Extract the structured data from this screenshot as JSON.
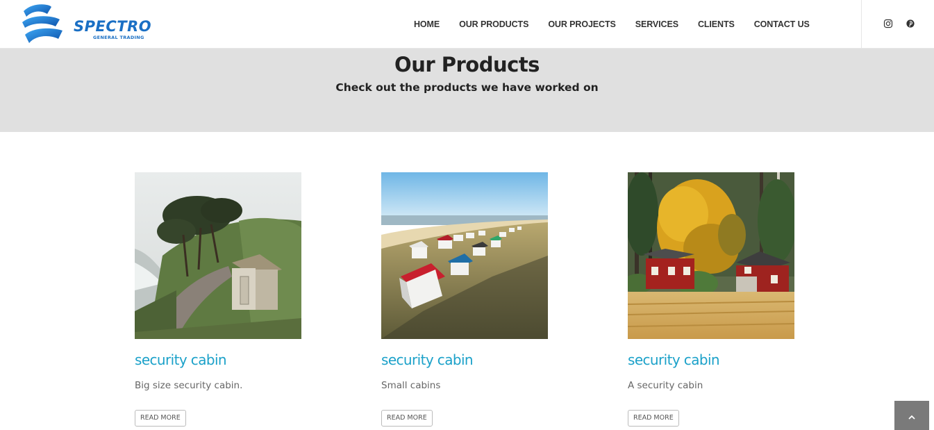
{
  "brand": {
    "name": "SPECTRO",
    "tagline": "GENERAL TRADING",
    "color": "#1a6fc4"
  },
  "nav": {
    "items": [
      {
        "label": "HOME"
      },
      {
        "label": "OUR PRODUCTS"
      },
      {
        "label": "OUR PROJECTS"
      },
      {
        "label": "SERVICES"
      },
      {
        "label": "CLIENTS"
      },
      {
        "label": "CONTACT US"
      }
    ]
  },
  "social": {
    "icons": [
      "instagram-icon",
      "pinterest-icon"
    ]
  },
  "banner": {
    "title": "Our Products",
    "subtitle": "Check out the products we have worked on"
  },
  "products": [
    {
      "title": "security cabin",
      "description": "Big size security cabin.",
      "button": "READ MORE",
      "image": "coastal-path-shed-photo"
    },
    {
      "title": "security cabin",
      "description": "Small cabins",
      "button": "READ MORE",
      "image": "beach-huts-photo"
    },
    {
      "title": "security cabin",
      "description": "A security cabin",
      "button": "READ MORE",
      "image": "red-cabins-autumn-photo"
    }
  ],
  "accent_color": "#1ba1c9",
  "back_to_top": {
    "icon": "chevron-up-icon"
  }
}
